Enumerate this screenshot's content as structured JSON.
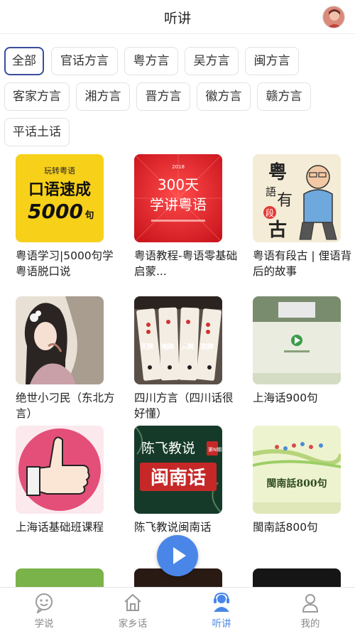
{
  "header": {
    "title": "听讲"
  },
  "categories": [
    {
      "label": "全部",
      "active": true
    },
    {
      "label": "官话方言"
    },
    {
      "label": "粤方言"
    },
    {
      "label": "吴方言"
    },
    {
      "label": "闽方言"
    },
    {
      "label": "客家方言"
    },
    {
      "label": "湘方言"
    },
    {
      "label": "晋方言"
    },
    {
      "label": "徽方言"
    },
    {
      "label": "赣方言"
    },
    {
      "label": "平话土话"
    }
  ],
  "cards": [
    {
      "title": "粤语学习|5000句学粤语脱口说",
      "cover_text": {
        "top": "玩转粤语",
        "main": "口语速成",
        "num": "5000",
        "suffix": "句"
      }
    },
    {
      "title": "粤语教程-粤语零基础启蒙...",
      "cover_text": {
        "top": "300天",
        "main": "学讲粤语",
        "year": "2018"
      }
    },
    {
      "title": "粤语有段古 | 俚语背后的故事",
      "cover_text": {
        "c1": "粤",
        "c2": "語",
        "c3": "有",
        "c4": "段",
        "c5": "古"
      }
    },
    {
      "title": "绝世小刁民（东北方言）"
    },
    {
      "title": "四川方言（四川话很好懂）",
      "cover_text": {
        "t1": "天牌",
        "t2": "地牌",
        "t3": "人牌",
        "t4": "和牌"
      }
    },
    {
      "title": "上海话900句"
    },
    {
      "title": "上海话基础班课程"
    },
    {
      "title": "陈飞教说闽南话",
      "cover_text": {
        "top": "陈飞教说",
        "main": "闽南话",
        "badge": "第N期"
      }
    },
    {
      "title": "閩南話800句",
      "cover_text": {
        "main": "閩南話800句"
      }
    }
  ],
  "tabs": [
    {
      "label": "学说",
      "icon": "chat-bubble-icon"
    },
    {
      "label": "家乡话",
      "icon": "home-icon"
    },
    {
      "label": "听讲",
      "icon": "listen-person-icon",
      "active": true
    },
    {
      "label": "我的",
      "icon": "user-icon"
    }
  ],
  "colors": {
    "accent": "#4a86e8",
    "chip_active_border": "#3a4d9c"
  }
}
